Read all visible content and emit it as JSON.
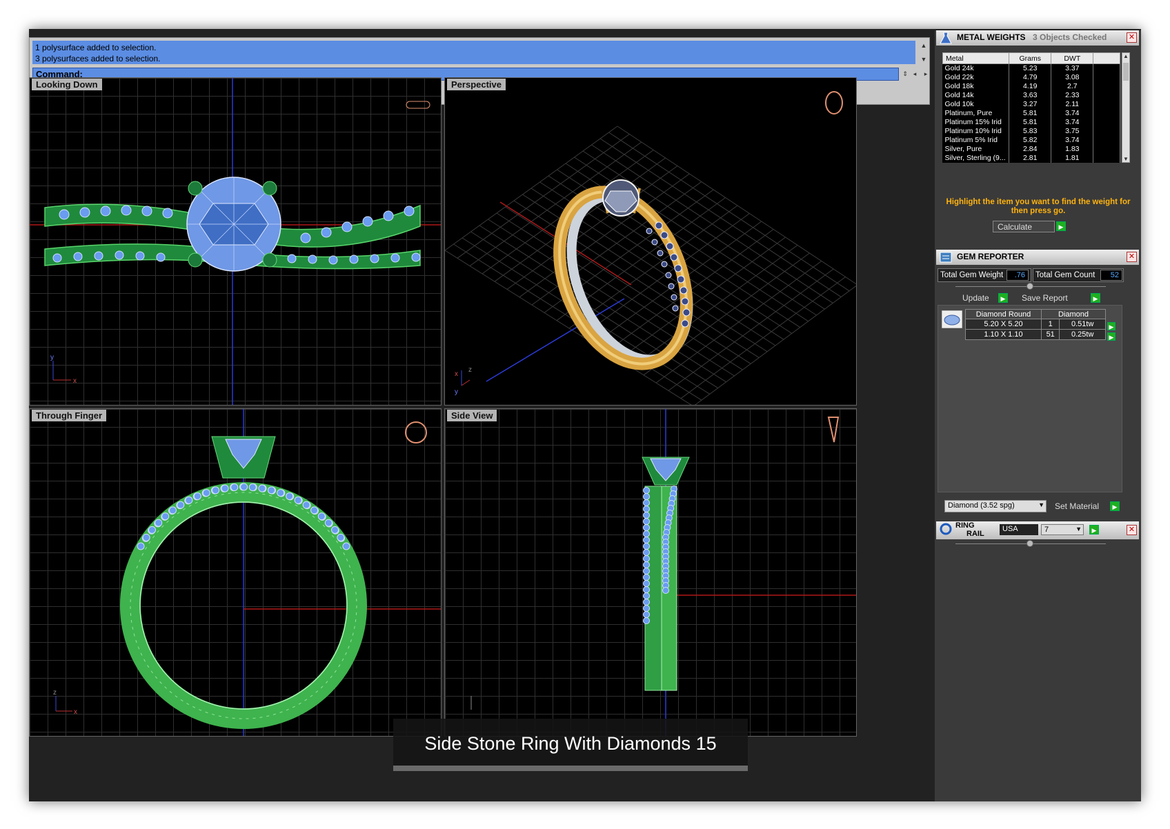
{
  "command": {
    "history": [
      "1 polysurface added to selection.",
      "3 polysurfaces added to selection."
    ],
    "prompt": "Command:"
  },
  "viewports": {
    "top": "Looking Down",
    "persp": "Perspective",
    "front": "Through Finger",
    "side": "Side View"
  },
  "axis": {
    "x": "x",
    "y": "y",
    "z": "z"
  },
  "metal_weights": {
    "title": "METAL WEIGHTS",
    "checked": "3 Objects Checked",
    "headers": [
      "Metal",
      "Grams",
      "DWT"
    ],
    "rows": [
      [
        "Gold 24k",
        "5.23",
        "3.37"
      ],
      [
        "Gold 22k",
        "4.79",
        "3.08"
      ],
      [
        "Gold 18k",
        "4.19",
        "2.7"
      ],
      [
        "Gold 14k",
        "3.63",
        "2.33"
      ],
      [
        "Gold 10k",
        "3.27",
        "2.11"
      ],
      [
        "Platinum, Pure",
        "5.81",
        "3.74"
      ],
      [
        "Platinum 15% Irid",
        "5.81",
        "3.74"
      ],
      [
        "Platinum 10% Irid",
        "5.83",
        "3.75"
      ],
      [
        "Platinum 5% Irid",
        "5.82",
        "3.74"
      ],
      [
        "Silver, Pure",
        "2.84",
        "1.83"
      ],
      [
        "Silver, Sterling (9...",
        "2.81",
        "1.81"
      ]
    ],
    "note": "Highlight the item you want to find the weight for then press go.",
    "calc": "Calculate"
  },
  "gem_reporter": {
    "title": "GEM REPORTER",
    "weight_label": "Total Gem Weight",
    "weight": ".76",
    "count_label": "Total Gem Count",
    "count": "52",
    "update": "Update",
    "save": "Save Report",
    "headers": [
      "Diamond Round",
      "Diamond"
    ],
    "rows": [
      [
        "5.20 X 5.20",
        "1",
        "0.51tw"
      ],
      [
        "1.10 X 1.10",
        "51",
        "0.25tw"
      ]
    ],
    "material": "Diamond    (3.52 spg)",
    "set_material": "Set Material"
  },
  "ring_rail": {
    "title_a": "RING",
    "title_b": "RAIL",
    "country": "USA",
    "size": "7"
  },
  "caption": "Side Stone Ring With Diamonds 15",
  "colors": {
    "wire_green": "#39c24a",
    "gem_blue": "#7aa9ff",
    "gold": "#d9a441",
    "accent": "#ffb30f"
  }
}
